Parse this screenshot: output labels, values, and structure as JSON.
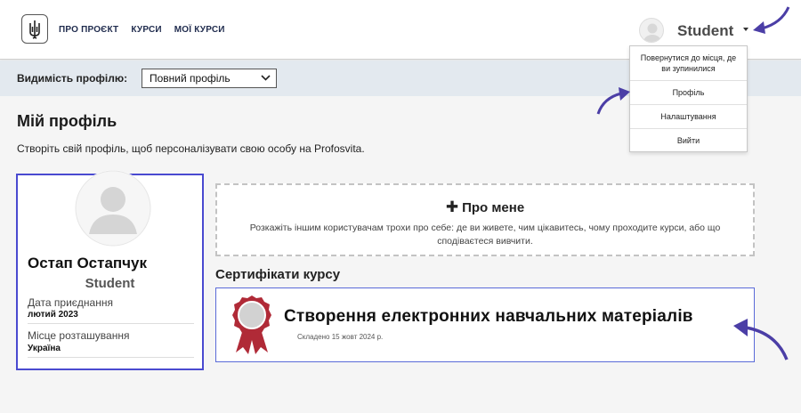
{
  "header": {
    "nav": [
      "ПРО ПРОЄКТ",
      "КУРСИ",
      "МОЇ КУРСИ"
    ],
    "user_name": "Student"
  },
  "user_menu": {
    "items": [
      "Повернутися до місця, де ви зупинилися",
      "Профіль",
      "Налаштування",
      "Вийти"
    ]
  },
  "visibility": {
    "label": "Видимість профілю:",
    "selected": "Повний профіль"
  },
  "page": {
    "title": "Мій профіль",
    "subtitle": "Створіть свій профіль, щоб персоналізувати свою особу на Profosvita."
  },
  "profile": {
    "name": "Остап Остапчук",
    "role": "Student",
    "join_label": "Дата приєднання",
    "join_value": "лютий 2023",
    "location_label": "Місце розташування",
    "location_value": "Україна"
  },
  "about": {
    "title": "Про мене",
    "text": "Розкажіть іншим користувачам трохи про себе: де ви живете, чим цікавитесь, чому проходите курси, або що сподіваєтеся вивчити."
  },
  "certificates": {
    "heading": "Сертифікати курсу",
    "items": [
      {
        "title": "Створення електронних навчальних матеріалів",
        "date": "Складено 15 жовт 2024 р."
      }
    ]
  },
  "colors": {
    "accent": "#4a4ad0",
    "arrow": "#4b3ea6",
    "badge": "#b02a37"
  }
}
